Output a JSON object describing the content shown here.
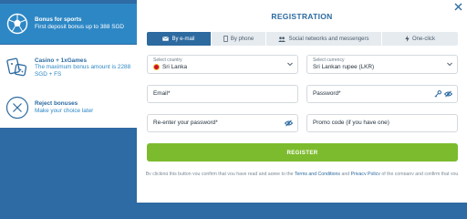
{
  "bonus": {
    "sports": {
      "title": "Bonus for sports",
      "subtitle": "First deposit bonus up to 388 SGD",
      "icon": "soccer-ball-icon"
    },
    "casino": {
      "title": "Casino + 1xGames",
      "subtitle": "The maximum bonus amount is 2288 SGD + FS",
      "icon": "dice-cards-icon"
    },
    "reject": {
      "title": "Reject bonuses",
      "subtitle": "Make your choice later",
      "icon": "close-circle-icon"
    }
  },
  "modal": {
    "title": "REGISTRATION",
    "close_icon": "close-icon",
    "tabs": [
      {
        "label": "By e-mail",
        "icon": "envelope-icon",
        "active": true
      },
      {
        "label": "By phone",
        "icon": "phone-icon",
        "active": false
      },
      {
        "label": "Social networks and messengers",
        "icon": "users-icon",
        "active": false
      },
      {
        "label": "One-click",
        "icon": "lightning-icon",
        "active": false
      }
    ],
    "country": {
      "label": "Select country",
      "value": "Sri Lanka"
    },
    "currency": {
      "label": "Select currency",
      "value": "Sri Lankan rupee (LKR)"
    },
    "email": {
      "placeholder": "Email*"
    },
    "password": {
      "placeholder": "Password*"
    },
    "reenter": {
      "placeholder": "Re-enter your password*"
    },
    "promo": {
      "placeholder": "Promo code (if you have one)"
    },
    "register_label": "REGISTER",
    "terms": {
      "prefix": "By clicking this button you confirm that you have read and agree to the",
      "terms_link": "Terms and Conditions",
      "and": "and",
      "privacy_link": "Privacy Policy",
      "suffix": "of the company and confirm that you are of legal age"
    }
  },
  "colors": {
    "accent": "#2c6aa0",
    "active_bonus": "#2d87c5",
    "register": "#7dbb2e",
    "background": "#2e6aa3"
  }
}
